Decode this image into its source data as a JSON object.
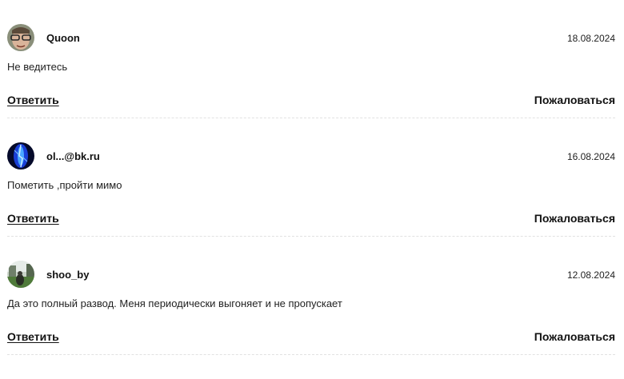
{
  "comments": [
    {
      "author": "Quoon",
      "date": "18.08.2024",
      "text": "Не ведитесь",
      "reply_label": "Ответить",
      "report_label": "Пожаловаться",
      "avatar_icon": "user-photo-avatar"
    },
    {
      "author": "ol...@bk.ru",
      "date": "16.08.2024",
      "text": "Пометить ,пройти мимо",
      "reply_label": "Ответить",
      "report_label": "Пожаловаться",
      "avatar_icon": "user-photo-avatar"
    },
    {
      "author": "shoo_by",
      "date": "12.08.2024",
      "text": "Да это полный развод. Меня периодически выгоняет и не пропускает",
      "reply_label": "Ответить",
      "report_label": "Пожаловаться",
      "avatar_icon": "user-photo-avatar"
    }
  ],
  "colors": {
    "text": "#222222",
    "divider": "#e2e2e2"
  }
}
